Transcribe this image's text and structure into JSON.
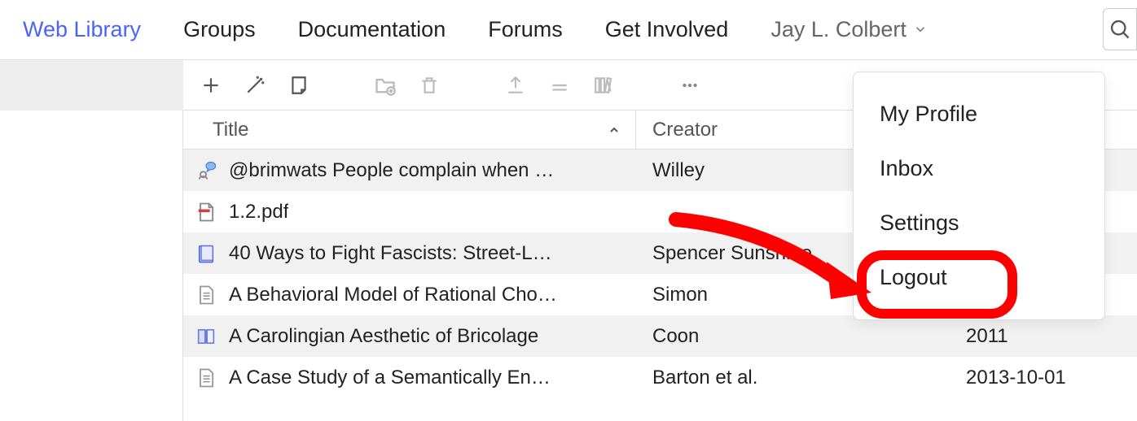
{
  "nav": {
    "web_library": "Web Library",
    "groups": "Groups",
    "documentation": "Documentation",
    "forums": "Forums",
    "get_involved": "Get Involved",
    "user_name": "Jay L. Colbert"
  },
  "dropdown": {
    "my_profile": "My Profile",
    "inbox": "Inbox",
    "settings": "Settings",
    "logout": "Logout"
  },
  "columns": {
    "title": "Title",
    "creator": "Creator"
  },
  "rows": [
    {
      "title": "@brimwats People complain when …",
      "creator": "Willey",
      "date": ""
    },
    {
      "title": "1.2.pdf",
      "creator": "",
      "date": ""
    },
    {
      "title": "40 Ways to Fight Fascists: Street-L…",
      "creator": "Spencer Sunshine",
      "date": ""
    },
    {
      "title": "A Behavioral Model of Rational Cho…",
      "creator": "Simon",
      "date": ""
    },
    {
      "title": "A Carolingian Aesthetic of Bricolage",
      "creator": "Coon",
      "date": "2011"
    },
    {
      "title": "A Case Study of a Semantically En…",
      "creator": "Barton et al.",
      "date": "2013-10-01"
    }
  ]
}
